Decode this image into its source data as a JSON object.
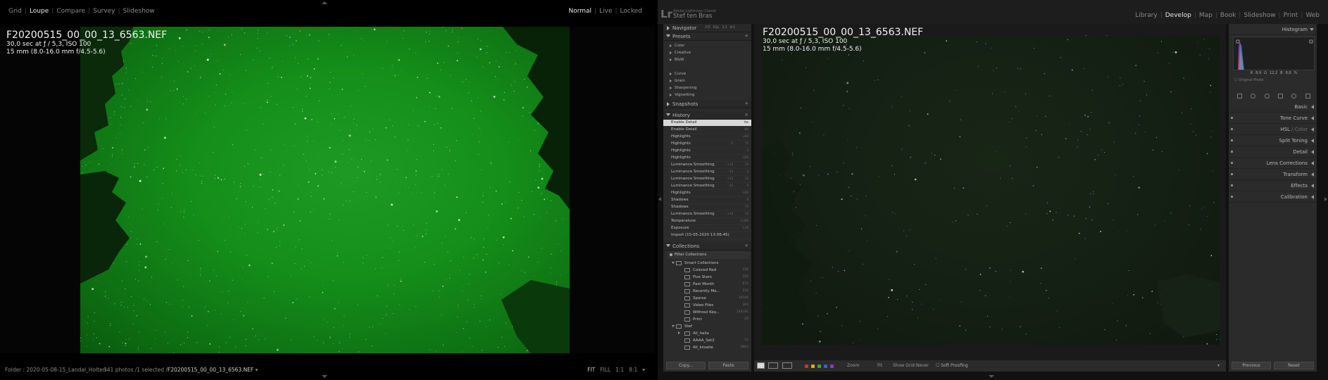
{
  "secondary": {
    "modes": [
      "Grid",
      "Loupe",
      "Compare",
      "Survey",
      "Slideshow"
    ],
    "active_mode": "Loupe",
    "views": [
      "Normal",
      "Live",
      "Locked"
    ],
    "active_view": "Normal",
    "info_title": "F20200515_00_00_13_6563.NEF",
    "info_exposure": "30,0 sec at ƒ / 5,3, ISO 100",
    "info_lens": "15 mm (8.0-16.0 mm f/4.5-5.6)",
    "folder": "Folder : 2020-05-08-15_Landal_Holten",
    "count_prefix": "341 photos /1 selected /",
    "count_file": "F20200515_00_00_13_6563.NEF",
    "zoom_options": [
      "FIT",
      "FILL",
      "1:1",
      "8:1"
    ]
  },
  "identity": {
    "logo": "Lr",
    "app": "Adobe Lightroom Classic",
    "user": "Stef ten Bras"
  },
  "modules": [
    "Library",
    "Develop",
    "Map",
    "Book",
    "Slideshow",
    "Print",
    "Web"
  ],
  "active_module": "Develop",
  "left_panel": {
    "navigator": {
      "label": "Navigator",
      "options": [
        "FIT",
        "FILL",
        "1:1",
        "8:1"
      ]
    },
    "presets": {
      "label": "Presets",
      "groups1": [
        "Color",
        "Creative",
        "B&W"
      ],
      "groups2": [
        "Curve",
        "Grain",
        "Sharpening",
        "Vignetting"
      ]
    },
    "snapshots": {
      "label": "Snapshots"
    },
    "history": {
      "label": "History",
      "items": [
        {
          "label": "Enable Detail",
          "v1": "",
          "v2": "Yes"
        },
        {
          "label": "Enable Detail",
          "v1": "",
          "v2": "No"
        },
        {
          "label": "Highlights",
          "v1": "",
          "v2": "+80"
        },
        {
          "label": "Highlights",
          "v1": "-5",
          "v2": "75"
        },
        {
          "label": "Highlights",
          "v1": "",
          "v2": "0"
        },
        {
          "label": "Highlights",
          "v1": "",
          "v2": "-100"
        },
        {
          "label": "Luminance Smoothing",
          "v1": "+14",
          "v2": "14"
        },
        {
          "label": "Luminance Smoothing",
          "v1": "-14",
          "v2": "0"
        },
        {
          "label": "Luminance Smoothing",
          "v1": "+13",
          "v2": "13"
        },
        {
          "label": "Luminance Smoothing",
          "v1": "-13",
          "v2": "0"
        },
        {
          "label": "Highlights",
          "v1": "",
          "v2": "-100"
        },
        {
          "label": "Shadows",
          "v1": "",
          "v2": "0"
        },
        {
          "label": "Shadows",
          "v1": "",
          "v2": "75"
        },
        {
          "label": "Luminance Smoothing",
          "v1": "+14",
          "v2": "14"
        },
        {
          "label": "Temperature",
          "v1": "",
          "v2": "2,200"
        },
        {
          "label": "Exposure",
          "v1": "",
          "v2": "1.00"
        },
        {
          "label": "Import (15-05-2020 13:06:45)",
          "v1": "",
          "v2": ""
        }
      ]
    },
    "collections": {
      "label": "Collections",
      "filter": "Filter Collections",
      "items": [
        {
          "label": "Smart Collections",
          "count": "",
          "level": 1,
          "kind": "set-open"
        },
        {
          "label": "Colored Red",
          "count": "220",
          "level": 2,
          "kind": "smart"
        },
        {
          "label": "Five Stars",
          "count": "200",
          "level": 2,
          "kind": "smart"
        },
        {
          "label": "Past Month",
          "count": "672",
          "level": 2,
          "kind": "smart"
        },
        {
          "label": "Recently Mo...",
          "count": "118",
          "level": 2,
          "kind": "smart"
        },
        {
          "label": "Sparse",
          "count": "16104",
          "level": 2,
          "kind": "smart"
        },
        {
          "label": "Video Files",
          "count": "363",
          "level": 2,
          "kind": "smart"
        },
        {
          "label": "Without Key...",
          "count": "120181",
          "level": 2,
          "kind": "smart"
        },
        {
          "label": "Print",
          "count": "20",
          "level": 2,
          "kind": "smart"
        },
        {
          "label": "Stef",
          "count": "",
          "level": 1,
          "kind": "set-open"
        },
        {
          "label": "Ali_haila",
          "count": "",
          "level": 2,
          "kind": "set-closed"
        },
        {
          "label": "AAAA_Set2",
          "count": "51",
          "level": 2,
          "kind": "coll"
        },
        {
          "label": "Ali_kroatie",
          "count": "2863",
          "level": 2,
          "kind": "coll"
        }
      ]
    }
  },
  "main": {
    "info_title": "F20200515_00_00_13_6563.NEF",
    "info_exposure": "30,0 sec at ƒ / 5,3, ISO 100",
    "info_lens": "15 mm (8.0-16.0 mm f/4.5-5.6)"
  },
  "right_panel": {
    "histogram": "Histogram",
    "hist_r_label": "R",
    "hist_r": "8,9",
    "hist_g_label": "G",
    "hist_g": "12,2",
    "hist_b_label": "B",
    "hist_b": "8,9",
    "hist_unit": "%",
    "original_photo": "Original Photo",
    "sections": [
      "Basic",
      "Tone Curve",
      "HSL",
      "Split Toning",
      "Detail",
      "Lens Corrections",
      "Transform",
      "Effects",
      "Calibration"
    ],
    "hsl_suffix": "/ Color"
  },
  "toolbar": {
    "copy": "Copy...",
    "paste": "Paste",
    "zoom_label": "Zoom",
    "fit_label": "Fit",
    "show_grid": "Show Grid:",
    "never": "Never",
    "soft_proofing": "Soft Proofing",
    "previous": "Previous",
    "reset": "Reset",
    "flag_colors": [
      "#c0392b",
      "#d4b20f",
      "#3ea13a",
      "#3564c8",
      "#8a3cc4"
    ]
  }
}
